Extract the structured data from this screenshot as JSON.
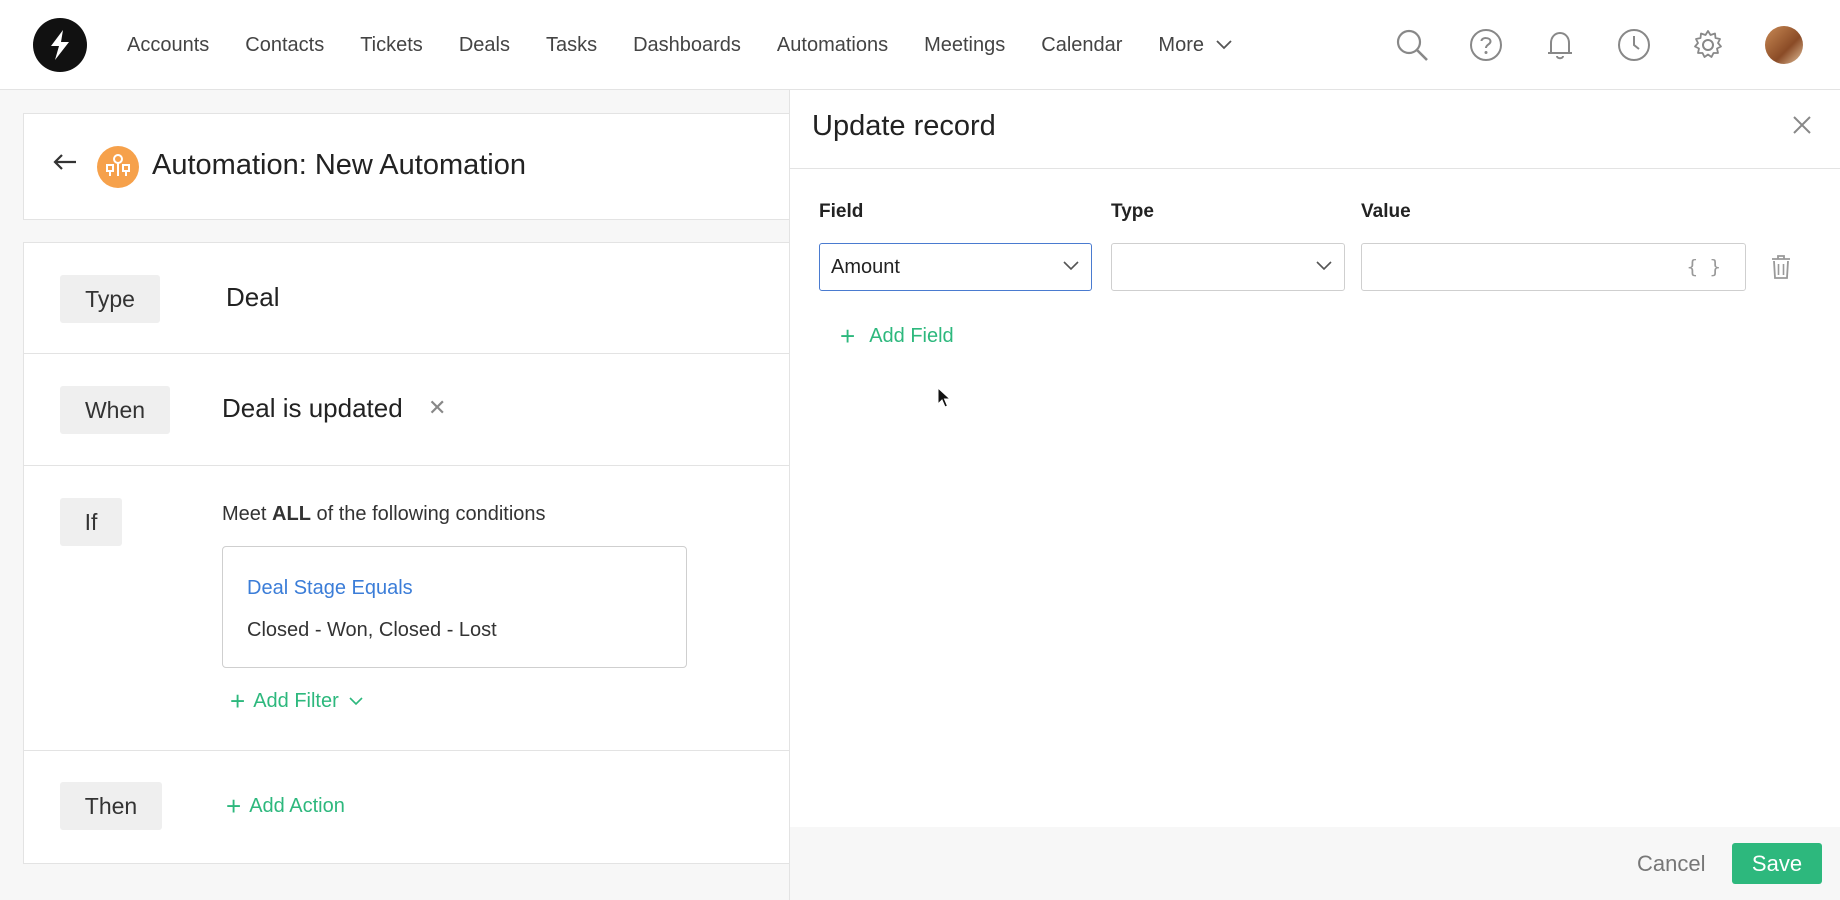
{
  "nav": {
    "items": [
      "Accounts",
      "Contacts",
      "Tickets",
      "Deals",
      "Tasks",
      "Dashboards",
      "Automations",
      "Meetings",
      "Calendar"
    ],
    "more_label": "More"
  },
  "header": {
    "title": "Automation: New Automation"
  },
  "rules": {
    "type_label": "Type",
    "type_value": "Deal",
    "when_label": "When",
    "when_value": "Deal is updated",
    "if_label": "If",
    "condition_intro_pre": "Meet ",
    "condition_intro_bold": "ALL",
    "condition_intro_post": " of the following conditions",
    "condition_title": "Deal Stage Equals",
    "condition_value": "Closed - Won, Closed - Lost",
    "add_filter_label": "Add Filter",
    "then_label": "Then",
    "add_action_label": "Add Action"
  },
  "drawer": {
    "title": "Update record",
    "columns": {
      "field": "Field",
      "type": "Type",
      "value": "Value"
    },
    "field_value": "Amount",
    "type_value": "",
    "value_value": "",
    "value_placeholder_icon": "{ }",
    "add_field_label": "Add Field",
    "cancel_label": "Cancel",
    "save_label": "Save"
  },
  "colors": {
    "accent_green": "#2db87d",
    "link_blue": "#3b7dd8",
    "automation_orange": "#f6a14b"
  }
}
